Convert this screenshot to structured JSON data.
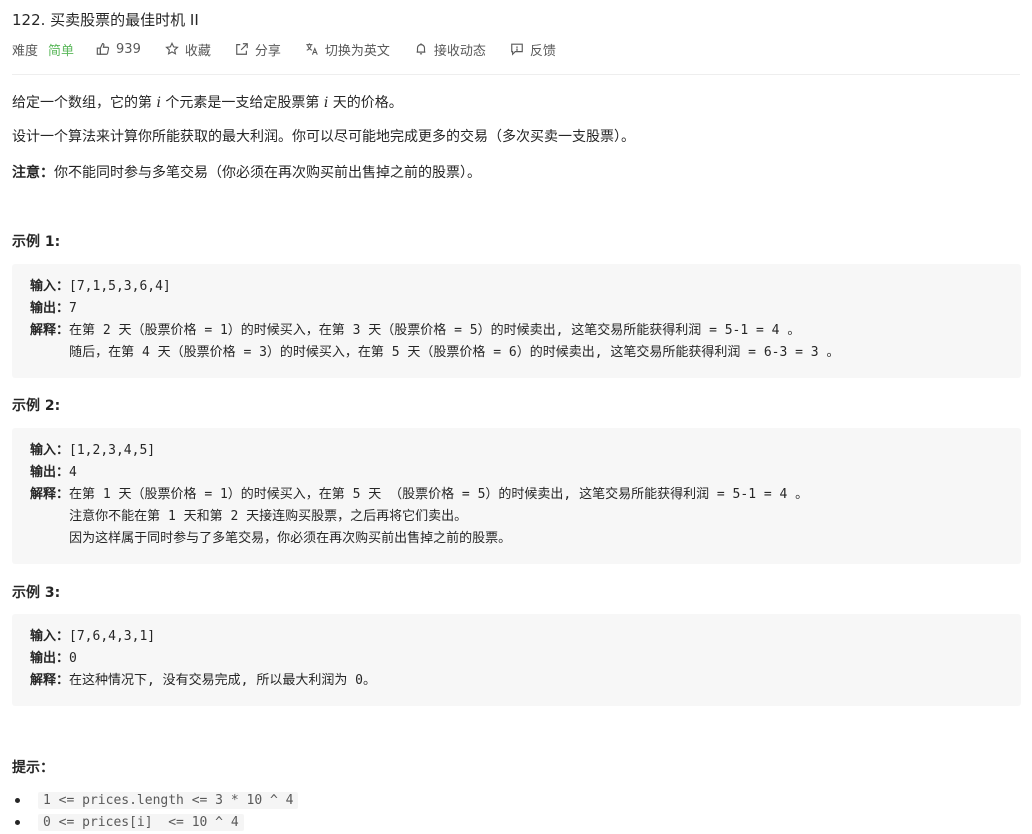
{
  "problem": {
    "title": "122. 买卖股票的最佳时机 II"
  },
  "meta": {
    "difficulty_label": "难度",
    "difficulty_value": "简单",
    "likes": "939",
    "favorite_label": "收藏",
    "share_label": "分享",
    "switch_lang_label": "切换为英文",
    "notify_label": "接收动态",
    "feedback_label": "反馈",
    "colors": {
      "easy": "#5cb85c",
      "text": "#262626",
      "muted": "#595959",
      "code_bg": "#f7f7f7"
    }
  },
  "description": {
    "p1_a": "给定一个数组，它的第 ",
    "p1_var1": "i",
    "p1_b": " 个元素是一支给定股票第 ",
    "p1_var2": "i",
    "p1_c": " 天的价格。",
    "p2": "设计一个算法来计算你所能获取的最大利润。你可以尽可能地完成更多的交易（多次买卖一支股票）。",
    "note_label": "注意：",
    "note_text": "你不能同时参与多笔交易（你必须在再次购买前出售掉之前的股票）。"
  },
  "examples": [
    {
      "title": "示例 1:",
      "input_label": "输入：",
      "input": "[7,1,5,3,6,4]",
      "output_label": "输出：",
      "output": "7",
      "explain_label": "解释：",
      "explain": [
        "在第 2 天（股票价格 = 1）的时候买入，在第 3 天（股票价格 = 5）的时候卖出, 这笔交易所能获得利润 = 5-1 = 4 。",
        "     随后，在第 4 天（股票价格 = 3）的时候买入，在第 5 天（股票价格 = 6）的时候卖出, 这笔交易所能获得利润 = 6-3 = 3 。"
      ]
    },
    {
      "title": "示例 2:",
      "input_label": "输入：",
      "input": "[1,2,3,4,5]",
      "output_label": "输出：",
      "output": "4",
      "explain_label": "解释：",
      "explain": [
        "在第 1 天（股票价格 = 1）的时候买入，在第 5 天 （股票价格 = 5）的时候卖出, 这笔交易所能获得利润 = 5-1 = 4 。",
        "     注意你不能在第 1 天和第 2 天接连购买股票，之后再将它们卖出。",
        "     因为这样属于同时参与了多笔交易，你必须在再次购买前出售掉之前的股票。"
      ]
    },
    {
      "title": "示例 3:",
      "input_label": "输入：",
      "input": "[7,6,4,3,1]",
      "output_label": "输出：",
      "output": "0",
      "explain_label": "解释：",
      "explain": [
        "在这种情况下, 没有交易完成, 所以最大利润为 0。"
      ]
    }
  ],
  "tips": {
    "title": "提示：",
    "items": [
      "1 <= prices.length <= 3 * 10 ^ 4",
      "0 <= prices[i]  <= 10 ^ 4"
    ]
  }
}
